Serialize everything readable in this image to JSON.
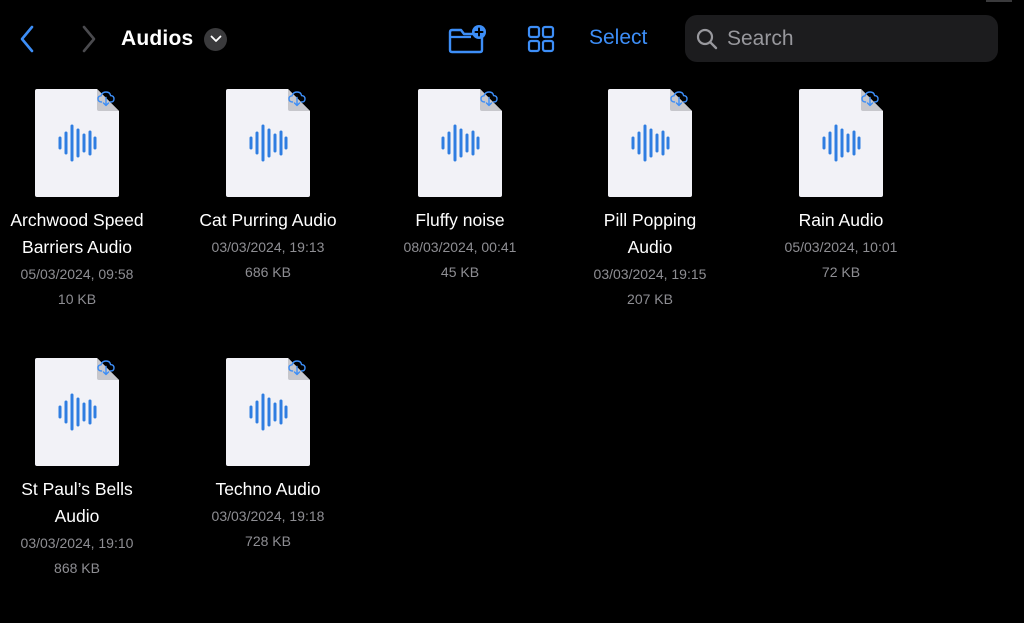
{
  "header": {
    "title": "Audios",
    "select_label": "Select",
    "search_placeholder": "Search"
  },
  "colors": {
    "background": "#000000",
    "accent": "#3d8ef7",
    "search_background": "#1c1c1e",
    "secondary_text": "#8e8e93",
    "document": "#f2f2f7"
  },
  "icons": {
    "back": "chevron-left-icon",
    "forward": "chevron-right-icon",
    "title_menu": "chevron-down-icon",
    "new_folder": "folder-plus-icon",
    "view_mode": "grid-icon",
    "search": "magnifying-glass-icon",
    "file": "audio-document-icon",
    "cloud": "cloud-download-icon"
  },
  "files": [
    {
      "name": "Archwood Speed Barriers Audio",
      "date": "05/03/2024, 09:58",
      "size": "10 KB"
    },
    {
      "name": "Cat Purring Audio",
      "date": "03/03/2024, 19:13",
      "size": "686 KB"
    },
    {
      "name": "Fluffy noise",
      "date": "08/03/2024, 00:41",
      "size": "45 KB"
    },
    {
      "name": "Pill Popping Audio",
      "date": "03/03/2024, 19:15",
      "size": "207 KB"
    },
    {
      "name": "Rain Audio",
      "date": "05/03/2024, 10:01",
      "size": "72 KB"
    },
    {
      "name": "St Paul’s Bells Audio",
      "date": "03/03/2024, 19:10",
      "size": "868 KB"
    },
    {
      "name": "Techno Audio",
      "date": "03/03/2024, 19:18",
      "size": "728 KB"
    }
  ]
}
